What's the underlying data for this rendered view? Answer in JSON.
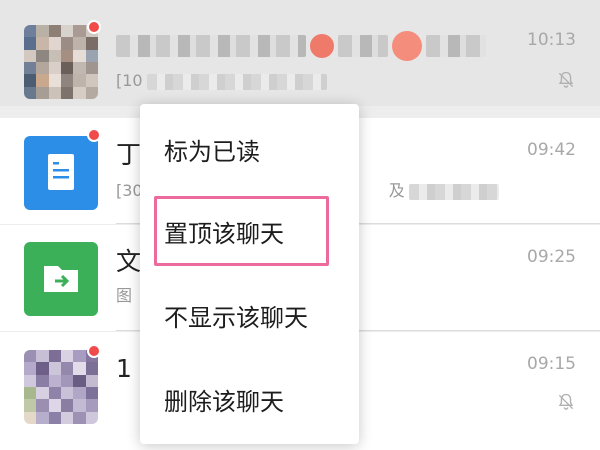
{
  "chats": [
    {
      "id": "chat-1",
      "title_fragment": "",
      "preview_fragment": "[10",
      "time": "10:13",
      "muted": true,
      "unread": true,
      "avatar": "photo-grid",
      "pressed": true
    },
    {
      "id": "chat-2",
      "title_fragment": "丁",
      "preview_fragment": "[30",
      "preview_fragment_2": "及",
      "time": "09:42",
      "muted": false,
      "unread": true,
      "avatar": "document-icon",
      "pressed": false
    },
    {
      "id": "chat-3",
      "title_fragment": "文",
      "preview_fragment": "图",
      "time": "09:25",
      "muted": false,
      "unread": false,
      "avatar": "folder-icon",
      "pressed": false
    },
    {
      "id": "chat-4",
      "title_fragment": "1",
      "preview_fragment": "",
      "time": "09:15",
      "muted": true,
      "unread": true,
      "avatar": "photo-grid",
      "pressed": false
    }
  ],
  "context_menu": {
    "items": [
      {
        "label": "标为已读"
      },
      {
        "label": "置顶该聊天",
        "highlighted": true
      },
      {
        "label": "不显示该聊天"
      },
      {
        "label": "删除该聊天"
      }
    ]
  },
  "colors": {
    "unread_dot": "#f04a4a",
    "highlight_border": "#ec6a9c",
    "doc_avatar": "#2c8ee6",
    "folder_avatar": "#3bb058"
  }
}
